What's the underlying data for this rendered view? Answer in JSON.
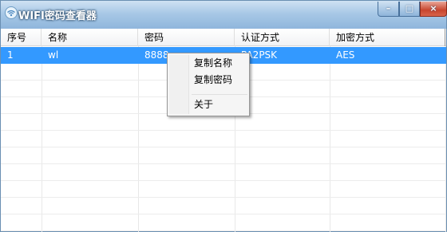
{
  "window": {
    "title": "WIFI密码查看器",
    "icon": "wifi-icon",
    "controls": {
      "minimize": "–",
      "maximize": "□",
      "close": "×"
    }
  },
  "table": {
    "columns": [
      "序号",
      "名称",
      "密码",
      "认证方式",
      "加密方式"
    ],
    "rows": [
      {
        "index": "1",
        "name": "wl",
        "password": "8888",
        "auth": "PA2PSK",
        "encryption": "AES"
      }
    ]
  },
  "context_menu": {
    "items": [
      "复制名称",
      "复制密码",
      "关于"
    ]
  },
  "colors": {
    "selection": "#3399ff",
    "title_gradient_top": "#cfe2f3",
    "title_gradient_bottom": "#8fb6dc",
    "close_button": "#c8452e"
  }
}
